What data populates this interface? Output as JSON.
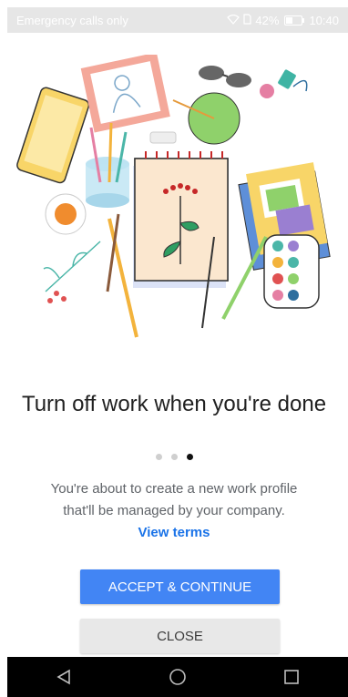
{
  "status": {
    "carrier": "Emergency calls only",
    "battery": "42%",
    "time": "10:40"
  },
  "onboarding": {
    "title": "Turn off work when you're done",
    "pager_total": 3,
    "pager_active": 3,
    "description": "You're about to create a new work profile that'll be managed by your company.",
    "terms_link": "View terms"
  },
  "actions": {
    "accept_label": "ACCEPT & CONTINUE",
    "close_label": "CLOSE"
  },
  "navigation": {
    "icons": [
      "back-icon",
      "home-icon",
      "recents-icon"
    ]
  },
  "colors": {
    "accent": "#4285f4",
    "link": "#1a73e8"
  }
}
